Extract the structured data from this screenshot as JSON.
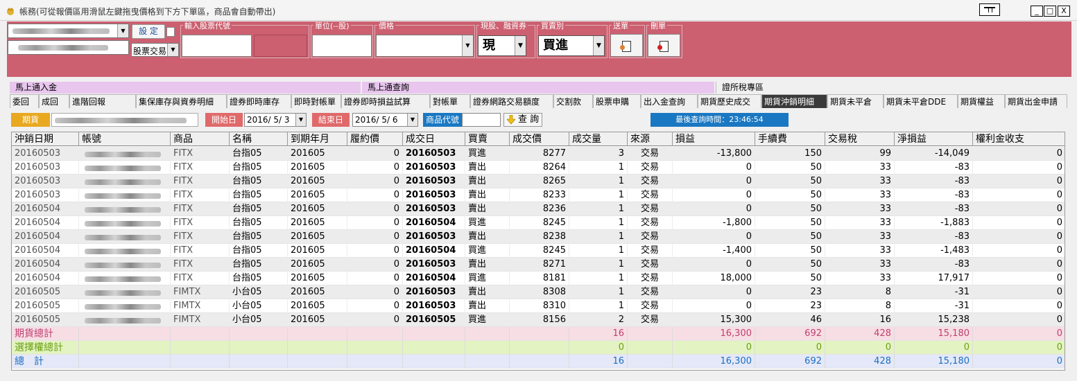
{
  "window": {
    "title": "帳務(可從報價區用滑鼠左鍵拖曳價格到下方下單區，商品會自動帶出)",
    "btn_min": "_",
    "btn_max": "□",
    "btn_close": "X"
  },
  "order_panel": {
    "set_button": "設 定",
    "trade_type": "股票交易",
    "stock_code_label": "輸入股票代號",
    "unit_label": "單位(--股)",
    "price_label": "價格",
    "cash_margin_label": "現股、融資券",
    "cash_margin_value": "現",
    "buy_sell_label": "買賣別",
    "buy_sell_value": "買進",
    "send_label": "送單",
    "delete_label": "刪單"
  },
  "strips": {
    "s1": "馬上通入金",
    "s2": "馬上通查詢",
    "s3": "證所稅專區"
  },
  "tabs": [
    "委回",
    "成回",
    "進階回報",
    "集保庫存與資券明細",
    "證券即時庫存",
    "即時對帳單",
    "證券即時損益試算",
    "對帳單",
    "證券網路交易額度",
    "交割款",
    "股票申購",
    "出入金查詢",
    "期貨歷史成交",
    "期貨沖銷明細",
    "期貨未平倉",
    "期貨未平倉DDE",
    "期貨權益",
    "期貨出金申請"
  ],
  "filter": {
    "market": "期貨",
    "start_label": "開始日",
    "start_date": "2016/ 5/ 3",
    "end_label": "結束日",
    "end_date": "2016/ 5/ 6",
    "code_label": "商品代號",
    "query_button": "查 詢",
    "last_query": "最後查詢時間：23:46:54"
  },
  "table": {
    "headers": [
      "沖銷日期",
      "帳號",
      "商品",
      "名稱",
      "到期年月",
      "履約價",
      "成交日",
      "買賣",
      "成交價",
      "成交量",
      "來源",
      "損益",
      "手續費",
      "交易稅",
      "淨損益",
      "權利金收支"
    ],
    "rows": [
      [
        "20160503",
        "",
        "FITX",
        "台指05",
        "201605",
        "0",
        "20160503",
        "買進",
        "8277",
        "3",
        "交易",
        "-13,800",
        "150",
        "99",
        "-14,049",
        "0"
      ],
      [
        "20160503",
        "",
        "FITX",
        "台指05",
        "201605",
        "0",
        "20160503",
        "賣出",
        "8264",
        "1",
        "交易",
        "0",
        "50",
        "33",
        "-83",
        "0"
      ],
      [
        "20160503",
        "",
        "FITX",
        "台指05",
        "201605",
        "0",
        "20160503",
        "賣出",
        "8265",
        "1",
        "交易",
        "0",
        "50",
        "33",
        "-83",
        "0"
      ],
      [
        "20160503",
        "",
        "FITX",
        "台指05",
        "201605",
        "0",
        "20160503",
        "賣出",
        "8233",
        "1",
        "交易",
        "0",
        "50",
        "33",
        "-83",
        "0"
      ],
      [
        "20160504",
        "",
        "FITX",
        "台指05",
        "201605",
        "0",
        "20160503",
        "賣出",
        "8236",
        "1",
        "交易",
        "0",
        "50",
        "33",
        "-83",
        "0"
      ],
      [
        "20160504",
        "",
        "FITX",
        "台指05",
        "201605",
        "0",
        "20160504",
        "買進",
        "8245",
        "1",
        "交易",
        "-1,800",
        "50",
        "33",
        "-1,883",
        "0"
      ],
      [
        "20160504",
        "",
        "FITX",
        "台指05",
        "201605",
        "0",
        "20160503",
        "賣出",
        "8238",
        "1",
        "交易",
        "0",
        "50",
        "33",
        "-83",
        "0"
      ],
      [
        "20160504",
        "",
        "FITX",
        "台指05",
        "201605",
        "0",
        "20160504",
        "買進",
        "8245",
        "1",
        "交易",
        "-1,400",
        "50",
        "33",
        "-1,483",
        "0"
      ],
      [
        "20160504",
        "",
        "FITX",
        "台指05",
        "201605",
        "0",
        "20160503",
        "賣出",
        "8271",
        "1",
        "交易",
        "0",
        "50",
        "33",
        "-83",
        "0"
      ],
      [
        "20160504",
        "",
        "FITX",
        "台指05",
        "201605",
        "0",
        "20160504",
        "買進",
        "8181",
        "1",
        "交易",
        "18,000",
        "50",
        "33",
        "17,917",
        "0"
      ],
      [
        "20160505",
        "",
        "FIMTX",
        "小台05",
        "201605",
        "0",
        "20160503",
        "賣出",
        "8308",
        "1",
        "交易",
        "0",
        "23",
        "8",
        "-31",
        "0"
      ],
      [
        "20160505",
        "",
        "FIMTX",
        "小台05",
        "201605",
        "0",
        "20160503",
        "賣出",
        "8310",
        "1",
        "交易",
        "0",
        "23",
        "8",
        "-31",
        "0"
      ],
      [
        "20160505",
        "",
        "FIMTX",
        "小台05",
        "201605",
        "0",
        "20160505",
        "買進",
        "8156",
        "2",
        "交易",
        "15,300",
        "46",
        "16",
        "15,238",
        "0"
      ]
    ],
    "totals": [
      {
        "label": "期貨總計",
        "qty": "16",
        "pl": "16,300",
        "fee": "692",
        "tax": "428",
        "net": "15,180",
        "premium": "0",
        "color": "#c04070",
        "bg": "#f7dde4"
      },
      {
        "label": "選擇權總計",
        "qty": "0",
        "pl": "0",
        "fee": "0",
        "tax": "0",
        "net": "0",
        "premium": "0",
        "color": "#6aa012",
        "bg": "#e4f3c2"
      },
      {
        "label": "總　計",
        "qty": "16",
        "pl": "16,300",
        "fee": "692",
        "tax": "428",
        "net": "15,180",
        "premium": "0",
        "color": "#1a6ec0",
        "bg": "#e4e8f8"
      }
    ]
  },
  "colors": {
    "accent_panel": "#cc6070",
    "tab_active": "#3a3a3a",
    "last_query_bg": "#1a78c2"
  }
}
